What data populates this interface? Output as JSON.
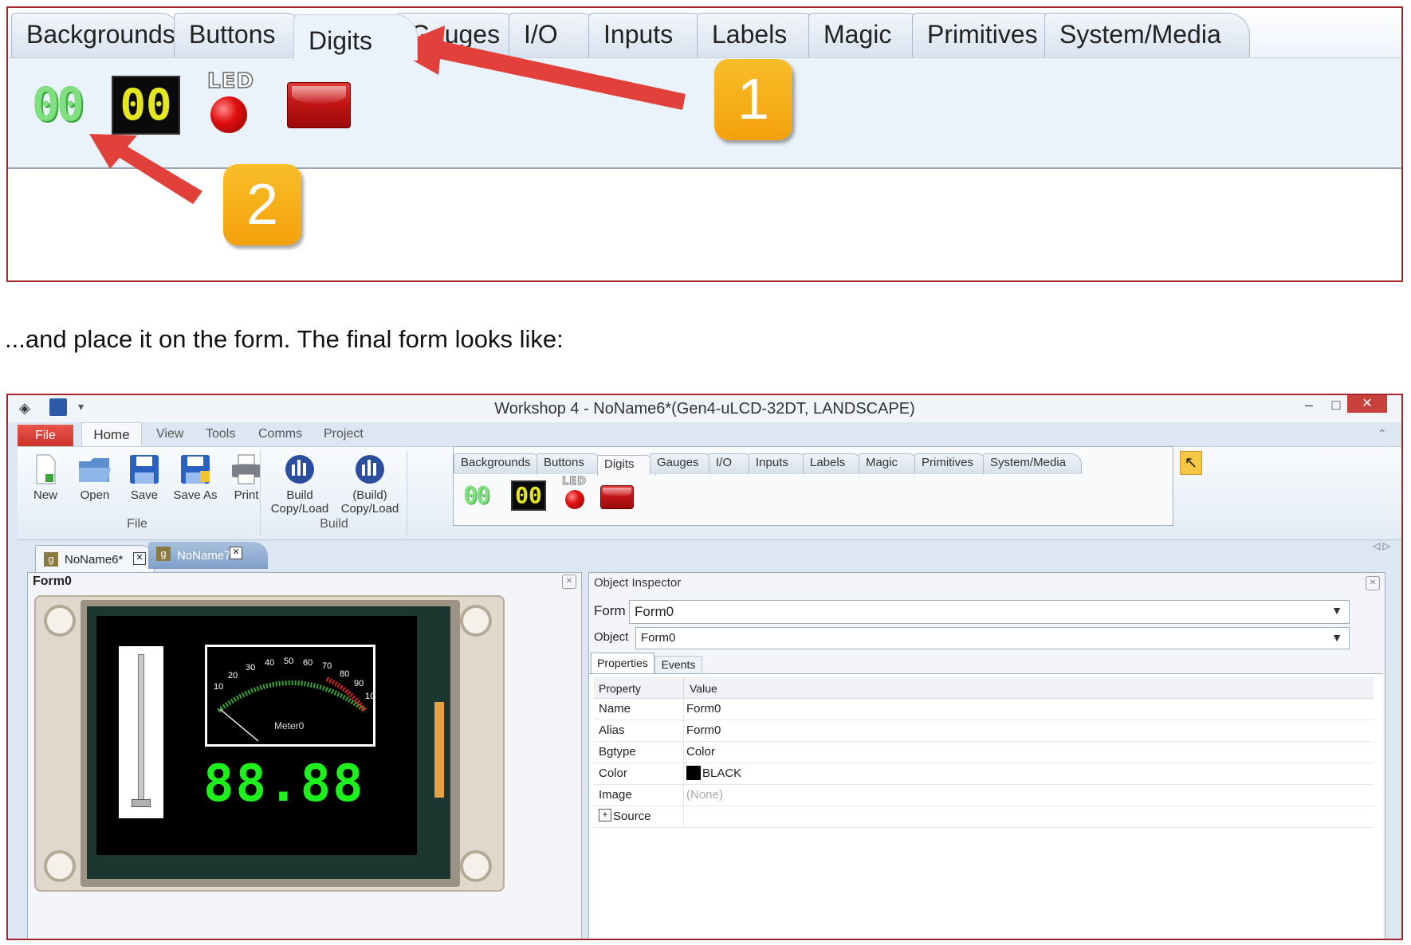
{
  "panel1": {
    "tabs": [
      "Backgrounds",
      "Buttons",
      "Digits",
      "Gauges",
      "I/O",
      "Inputs",
      "Labels",
      "Magic",
      "Primitives",
      "System/Media"
    ],
    "active_tab": "Digits",
    "widgets": {
      "green_digits": "00",
      "lcd_digits": "00",
      "led_label": "LED"
    },
    "callouts": [
      "1",
      "2"
    ],
    "callout_color": "#f5a81a",
    "arrow_color": "#e2403a"
  },
  "sentence": "...and place it on the form. The final form looks like:",
  "window": {
    "title": "Workshop 4 - NoName6*(Gen4-uLCD-32DT, LANDSCAPE)",
    "controls": {
      "minimize": "–",
      "maximize": "□",
      "close": "✕"
    },
    "menu": [
      "File",
      "Home",
      "View",
      "Tools",
      "Comms",
      "Project"
    ],
    "ribbon": {
      "file_group": {
        "buttons": [
          "New",
          "Open",
          "Save",
          "Save As",
          "Print"
        ],
        "label": "File"
      },
      "build_group": {
        "buttons": [
          [
            "Build",
            "Copy/Load"
          ],
          [
            "(Build)",
            "Copy/Load"
          ]
        ],
        "label": "Build"
      },
      "tabs": [
        "Backgrounds",
        "Buttons",
        "Digits",
        "Gauges",
        "I/O",
        "Inputs",
        "Labels",
        "Magic",
        "Primitives",
        "System/Media"
      ],
      "active_tab": "Digits",
      "widgets": {
        "green_digits": "00",
        "lcd_digits": "00",
        "led_label": "LED"
      }
    },
    "doc_tabs": [
      {
        "label": "NoName6*",
        "active": true
      },
      {
        "label": "NoName7*",
        "active": false
      }
    ],
    "form_pane": {
      "title": "Form0",
      "meter": {
        "ticks": [
          "10",
          "20",
          "30",
          "40",
          "50",
          "60",
          "70",
          "80",
          "90",
          "10"
        ],
        "label": "Meter0"
      },
      "led_digits": "88.88"
    },
    "inspector": {
      "title": "Object Inspector",
      "form_label": "Form",
      "form_value": "Form0",
      "object_label": "Object",
      "object_value": "Form0",
      "tabs": [
        "Properties",
        "Events"
      ],
      "columns": [
        "Property",
        "Value"
      ],
      "rows": [
        {
          "property": "Name",
          "value": "Form0"
        },
        {
          "property": "Alias",
          "value": "Form0"
        },
        {
          "property": "Bgtype",
          "value": "Color"
        },
        {
          "property": "Color",
          "value": "BLACK"
        },
        {
          "property": "Image",
          "value": "(None)"
        },
        {
          "property": "Source",
          "value": ""
        }
      ]
    }
  }
}
